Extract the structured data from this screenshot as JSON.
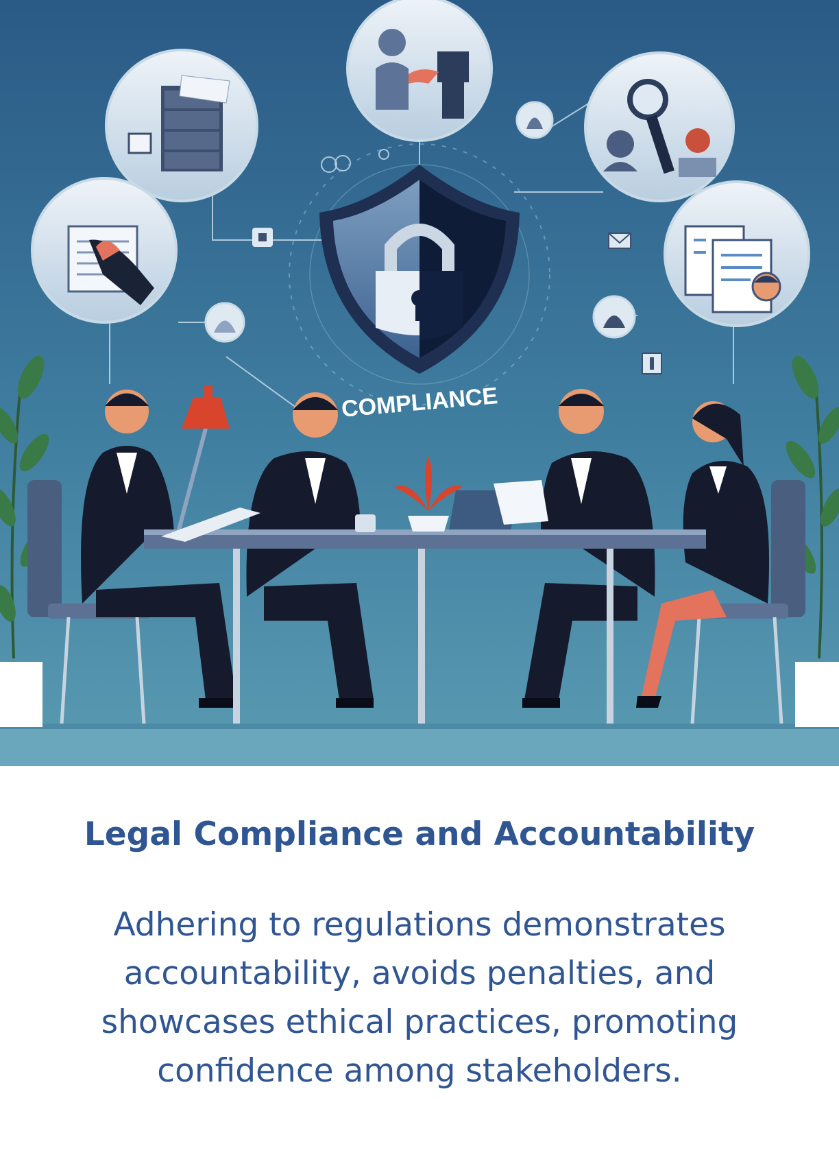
{
  "illustration": {
    "shield_label": "COMPLIANCE",
    "colors": {
      "background_top": "#2a5a86",
      "background_bottom": "#5a9bb2",
      "suit": "#151a2c",
      "accent_red": "#d9442c",
      "circle_fill": "#dfe9f1"
    },
    "icons": [
      "filing-cabinet-icon",
      "handshake-icon",
      "magnifier-icon",
      "document-sign-icon",
      "documents-icon",
      "shield-lock-icon"
    ]
  },
  "caption": {
    "title": "Legal Compliance and Accountability",
    "body": "Adhering to regulations demonstrates accountability, avoids penalties, and showcases ethical practices, promoting confidence among stakeholders."
  }
}
